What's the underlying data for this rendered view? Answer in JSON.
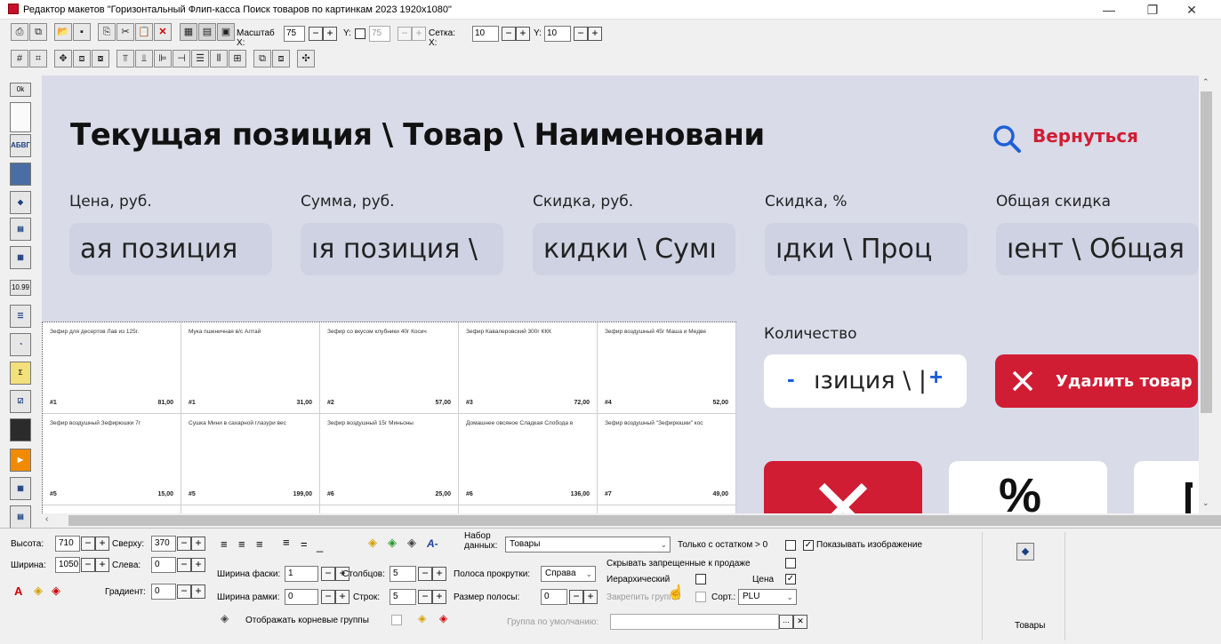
{
  "window": {
    "title": "Редактор макетов \"Горизонтальный Флип-касса Поиск товаров по картинкам 2023 1920x1080\"",
    "minimize": "—",
    "restore": "❐",
    "close": "✕"
  },
  "toolbar": {
    "scale_label": "Масштаб X:",
    "scale_x": "75",
    "y_label": "Y:",
    "scale_y": "75",
    "grid_label": "Сетка: X:",
    "grid_x": "10",
    "grid_y_label": "Y:",
    "grid_y": "10",
    "minus": "−",
    "plus": "+"
  },
  "palette": {
    "ok": "0k",
    "text_abv": "АБВГ",
    "price_value": "10.99"
  },
  "canvas": {
    "title": "Текущая позиция \\ Товар \\ Наименовани",
    "back_label": "Вернуться",
    "fields": [
      {
        "label": "Цена, руб.",
        "value": "ая позиция"
      },
      {
        "label": "Сумма, руб.",
        "value": "ıя позиция \\"
      },
      {
        "label": "Скидка, руб.",
        "value": "кидки \\ Сумı"
      },
      {
        "label": "Скидка, %",
        "value": "ıдки \\ Проц"
      },
      {
        "label": "Общая скидка",
        "value": "ıент \\ Общая"
      }
    ],
    "quantity_label": "Количество",
    "quantity_minus": "-",
    "quantity_value": "ıзиция \\ |",
    "quantity_plus": "+",
    "delete_label": "Удалить товар",
    "percent_symbol": "%",
    "grid_items": [
      {
        "name": "Зефир для десертов Лав из 125г.",
        "num": "#1",
        "price": "81,00"
      },
      {
        "name": "Мука пшеничная в/с Алтай",
        "num": "#1",
        "price": "31,00"
      },
      {
        "name": "Зефир со вкусом клубники 40г Косич",
        "num": "#2",
        "price": "57,00"
      },
      {
        "name": "Зефир Кавалеровский 300г ККК",
        "num": "#3",
        "price": "72,00"
      },
      {
        "name": "Зефир воздушный 45г Маша и Медве",
        "num": "#4",
        "price": "52,00"
      },
      {
        "name": "Зефир воздушный Зефирюшки 7г",
        "num": "#5",
        "price": "15,00"
      },
      {
        "name": "Сушка Мини в сахарной глазури вес",
        "num": "#5",
        "price": "199,00"
      },
      {
        "name": "Зефир воздушный 15г Миньоны",
        "num": "#6",
        "price": "25,00"
      },
      {
        "name": "Домашнее овсяное Сладкая Слобода в",
        "num": "#6",
        "price": "136,00"
      },
      {
        "name": "Зефир воздушный \"Зефирюшки\" кос",
        "num": "#7",
        "price": "49,00"
      }
    ]
  },
  "props": {
    "height_label": "Высота:",
    "height": "710",
    "top_label": "Сверху:",
    "top": "370",
    "width_label": "Ширина:",
    "width": "1050",
    "left_label": "Слева:",
    "left": "0",
    "gradient_label": "Градиент:",
    "gradient": "0",
    "chamfer_label": "Ширина фаски:",
    "chamfer": "1",
    "columns_label": "Столбцов:",
    "columns": "5",
    "frame_label": "Ширина рамки:",
    "frame": "0",
    "rows_label": "Строк:",
    "rows": "5",
    "dataset_label": "Набор данных:",
    "dataset": "Товары",
    "scrollbar_label": "Полоса прокрутки:",
    "scrollbar": "Справа",
    "scroll_size_label": "Размер полосы:",
    "scroll_size": "0",
    "only_stock": "Только с остатком > 0",
    "show_image": "Показывать изображение",
    "hide_forbidden": "Скрывать запрещенные к продаже",
    "hierarchical": "Иерархический",
    "price": "Цена",
    "pin_groups": "Закрепить группы",
    "sort_label": "Сорт.:",
    "sort": "PLU",
    "show_root_groups": "Отображать корневые группы",
    "default_group_label": "Группа по умолчанию:",
    "default_group_btn": "...",
    "default_group_clear": "✕",
    "preview_label": "Товары"
  }
}
